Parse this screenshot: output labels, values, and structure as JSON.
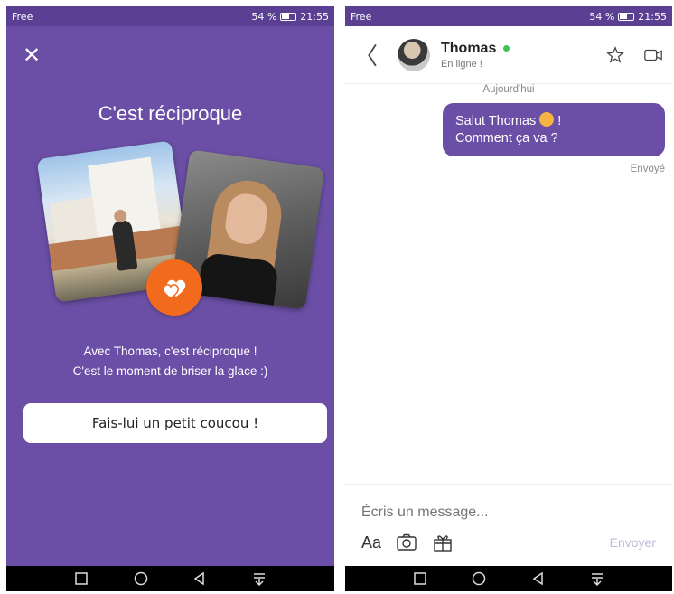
{
  "left": {
    "status_bar": {
      "carrier": "Free",
      "battery": "54 %",
      "time": "21:55"
    },
    "close_icon": "close-icon",
    "title": "C'est réciproque",
    "message_line1": "Avec Thomas, c'est réciproque !",
    "message_line2": "C'est le moment de briser la glace :)",
    "cta_label": "Fais-lui un petit coucou !",
    "colors": {
      "background": "#6b4fa6",
      "badge": "#f26b1d"
    }
  },
  "right": {
    "status_bar": {
      "carrier": "Free",
      "battery": "54 %",
      "time": "21:55"
    },
    "contact_name": "Thomas",
    "contact_status": "En ligne !",
    "day_label": "Aujourd'hui",
    "message_text_1": "Salut Thomas",
    "message_text_2": "!",
    "message_line2": "Comment ça va ?",
    "delivery_status": "Envoyé",
    "input_placeholder": "Écris un message...",
    "format_label": "Aa",
    "send_label": "Envoyer",
    "colors": {
      "bubble": "#6b4fa6",
      "online": "#43c05a"
    }
  }
}
